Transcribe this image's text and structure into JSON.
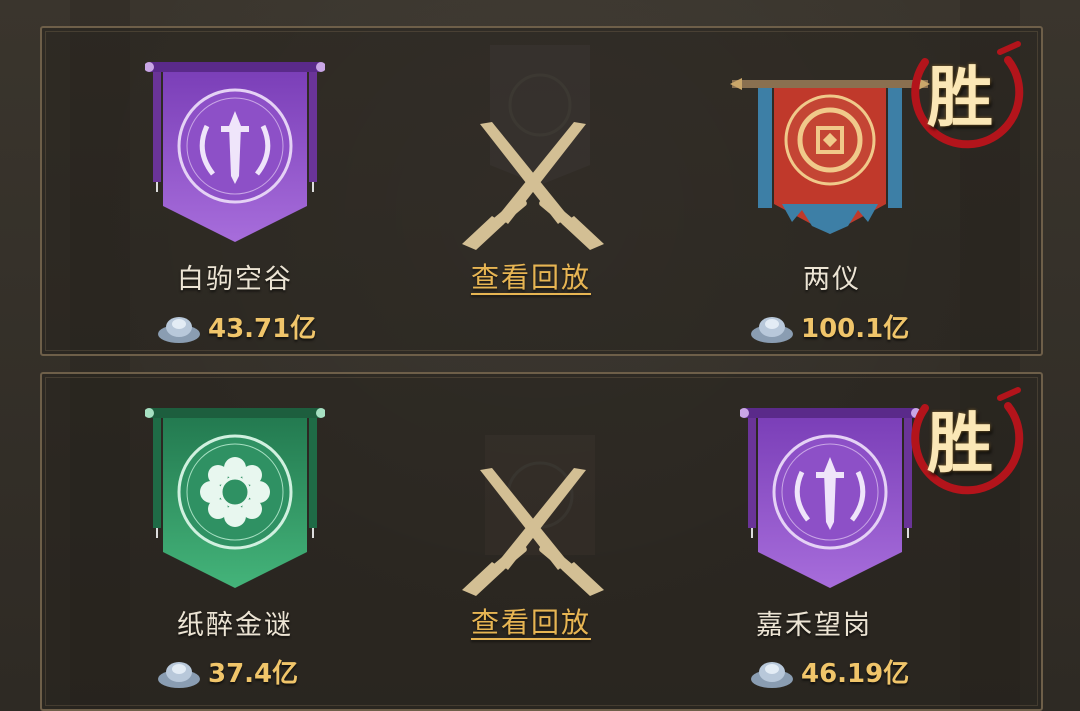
{
  "matches": [
    {
      "left": {
        "name": "白驹空谷",
        "power": "43.71亿",
        "banner": "purple-sword-emblem"
      },
      "right": {
        "name": "两仪",
        "power": "100.1亿",
        "banner": "red-coin-emblem",
        "result": "胜"
      },
      "replay_label": "查看回放"
    },
    {
      "left": {
        "name": "纸醉金谜",
        "power": "37.4亿",
        "banner": "green-flower-emblem"
      },
      "right": {
        "name": "嘉禾望岗",
        "power": "46.19亿",
        "banner": "purple-sword-emblem",
        "result": "胜"
      },
      "replay_label": "查看回放"
    }
  ],
  "colors": {
    "gold": "#e7b553",
    "power": "#f0c56a",
    "win_ring": "#b3141b",
    "purple": "#8a46c6",
    "green": "#33a36b",
    "red": "#c0392b"
  }
}
